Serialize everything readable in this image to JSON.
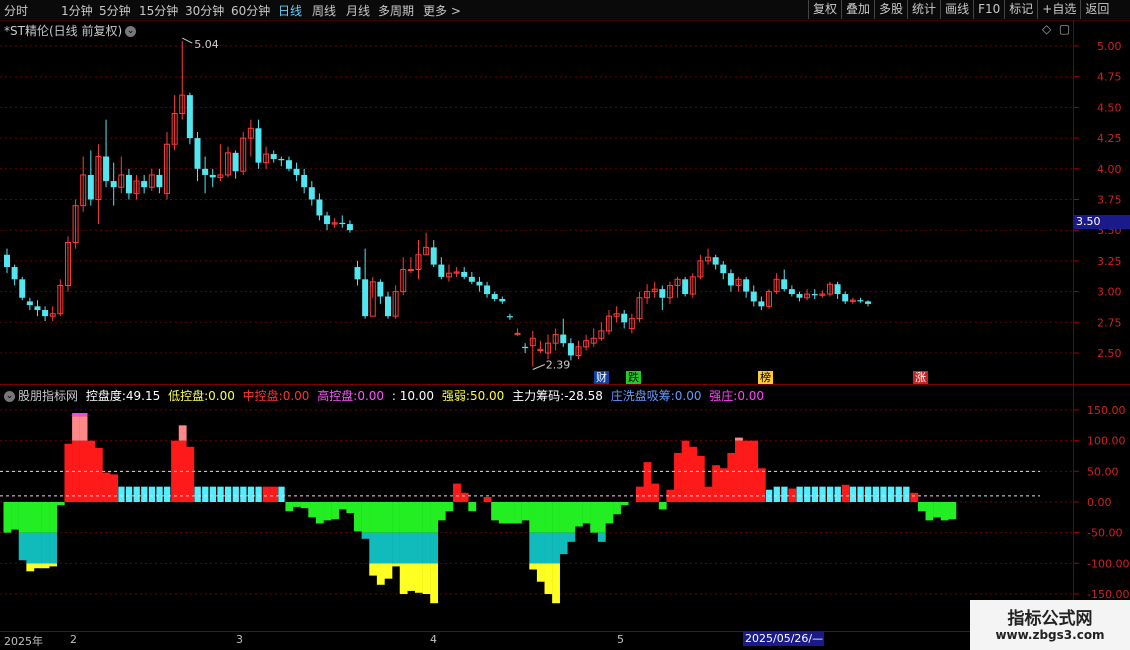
{
  "toolbar": {
    "periods": [
      "分时",
      "1分钟",
      "5分钟",
      "15分钟",
      "30分钟",
      "60分钟",
      "日线",
      "周线",
      "月线",
      "多周期",
      "更多 >"
    ],
    "active_period": "日线",
    "right_buttons": [
      "复权",
      "叠加",
      "多股",
      "统计",
      "画线",
      "F10",
      "标记",
      "+自选",
      "返回"
    ]
  },
  "chart": {
    "title": "*ST精伦(日线 前复权)",
    "high_marker": "5.04",
    "low_marker": "2.39",
    "current_price": "3.50",
    "price_ticks": [
      "5.00",
      "4.75",
      "4.50",
      "4.25",
      "4.00",
      "3.75",
      "3.50",
      "3.25",
      "3.00",
      "2.75",
      "2.50"
    ]
  },
  "badges": {
    "cai": "财",
    "die": "跌",
    "bang": "榜",
    "zhang": "涨"
  },
  "indicator": {
    "name": "股朋指标网",
    "kongpan_label": "控盘度:",
    "kongpan_value": "49.15",
    "low_label": "低控盘:",
    "low_value": "0.00",
    "mid_label": "中控盘:",
    "mid_value": "0.00",
    "high_label": "高控盘:",
    "high_value": "0.00",
    "sep_value": ": 10.00",
    "qiangruo_label": "强弱:",
    "qiangruo_value": "50.00",
    "chouma_label": "主力筹码:",
    "chouma_value": "-28.58",
    "xipan_label": "庄洗盘吸筹:",
    "xipan_value": "0.00",
    "qiangzhuang_label": "强庄:",
    "qiangzhuang_value": "0.00",
    "ticks": [
      "150.00",
      "100.00",
      "50.00",
      "0.00",
      "-50.00",
      "-100.00",
      "-150.00"
    ]
  },
  "dates": {
    "year": "2025年",
    "m2": "2",
    "m3": "3",
    "m4": "4",
    "m5": "5",
    "cursor": "2025/05/26/—"
  },
  "watermark": {
    "line1": "指标公式网",
    "line2": "www.zbgs3.com"
  },
  "colors": {
    "up": "#ff3b3b",
    "down": "#54e6f0",
    "bar_red": "#ff1a1a",
    "bar_pink": "#ff8888",
    "bar_magenta": "#ff44ff",
    "bar_green": "#22ee22",
    "bar_teal": "#11bbbb",
    "bar_yellow": "#ffff22",
    "bar_cyan": "#55eeff"
  },
  "chart_data": {
    "type": "candlestick+bar",
    "candles": [
      [
        3.3,
        3.2,
        3.35,
        3.15
      ],
      [
        3.2,
        3.1,
        3.22,
        3.05
      ],
      [
        3.1,
        2.95,
        3.12,
        2.93
      ],
      [
        2.92,
        2.89,
        2.95,
        2.85
      ],
      [
        2.88,
        2.85,
        2.93,
        2.8
      ],
      [
        2.85,
        2.8,
        2.88,
        2.76
      ],
      [
        2.8,
        2.82,
        2.88,
        2.76
      ],
      [
        2.82,
        3.05,
        3.1,
        2.8
      ],
      [
        3.05,
        3.4,
        3.45,
        3.0
      ],
      [
        3.4,
        3.7,
        3.75,
        3.35
      ],
      [
        3.7,
        3.95,
        4.1,
        3.65
      ],
      [
        3.95,
        3.75,
        4.15,
        3.7
      ],
      [
        3.75,
        4.1,
        4.2,
        3.55
      ],
      [
        4.1,
        3.9,
        4.4,
        3.85
      ],
      [
        3.9,
        3.85,
        4.05,
        3.7
      ],
      [
        3.85,
        3.95,
        4.1,
        3.8
      ],
      [
        3.95,
        3.8,
        4.0,
        3.75
      ],
      [
        3.8,
        3.9,
        3.95,
        3.75
      ],
      [
        3.9,
        3.85,
        3.95,
        3.8
      ],
      [
        3.85,
        3.95,
        4.0,
        3.82
      ],
      [
        3.95,
        3.85,
        4.0,
        3.8
      ],
      [
        3.8,
        4.2,
        4.3,
        3.75
      ],
      [
        4.2,
        4.45,
        4.6,
        4.15
      ],
      [
        4.45,
        4.6,
        5.04,
        4.4
      ],
      [
        4.6,
        4.25,
        4.62,
        4.2
      ],
      [
        4.25,
        4.0,
        4.3,
        3.9
      ],
      [
        4.0,
        3.95,
        4.1,
        3.8
      ],
      [
        3.95,
        3.93,
        4.0,
        3.85
      ],
      [
        3.93,
        3.95,
        4.2,
        3.9
      ],
      [
        3.95,
        4.13,
        4.18,
        3.93
      ],
      [
        4.13,
        3.98,
        4.15,
        3.92
      ],
      [
        3.98,
        4.25,
        4.3,
        3.95
      ],
      [
        4.25,
        4.33,
        4.4,
        4.1
      ],
      [
        4.33,
        4.05,
        4.4,
        4.0
      ],
      [
        4.05,
        4.12,
        4.18,
        4.0
      ],
      [
        4.12,
        4.08,
        4.15,
        4.05
      ],
      [
        4.08,
        4.07,
        4.1,
        4.02
      ],
      [
        4.07,
        4.0,
        4.1,
        3.98
      ],
      [
        4.0,
        3.95,
        4.05,
        3.9
      ],
      [
        3.95,
        3.85,
        4.0,
        3.8
      ],
      [
        3.85,
        3.75,
        3.9,
        3.7
      ],
      [
        3.75,
        3.62,
        3.8,
        3.58
      ],
      [
        3.62,
        3.55,
        3.65,
        3.5
      ],
      [
        3.55,
        3.56,
        3.6,
        3.52
      ],
      [
        3.56,
        3.55,
        3.62,
        3.52
      ],
      [
        3.55,
        3.5,
        3.58,
        3.48
      ],
      [
        3.2,
        3.1,
        3.25,
        3.05
      ],
      [
        3.1,
        2.8,
        3.35,
        2.78
      ],
      [
        2.8,
        3.08,
        3.12,
        2.95
      ],
      [
        3.08,
        2.96,
        3.1,
        2.9
      ],
      [
        2.96,
        2.8,
        3.0,
        2.78
      ],
      [
        2.8,
        3.0,
        3.05,
        2.78
      ],
      [
        3.0,
        3.18,
        3.28,
        2.97
      ],
      [
        3.18,
        3.18,
        3.28,
        3.15
      ],
      [
        3.18,
        3.3,
        3.42,
        3.1
      ],
      [
        3.3,
        3.36,
        3.48,
        3.3
      ],
      [
        3.36,
        3.22,
        3.42,
        3.2
      ],
      [
        3.22,
        3.12,
        3.28,
        3.1
      ],
      [
        3.12,
        3.15,
        3.22,
        3.08
      ],
      [
        3.15,
        3.16,
        3.2,
        3.12
      ],
      [
        3.16,
        3.12,
        3.2,
        3.1
      ],
      [
        3.12,
        3.08,
        3.16,
        3.06
      ],
      [
        3.08,
        3.05,
        3.12,
        3.0
      ],
      [
        3.05,
        2.98,
        3.08,
        2.95
      ],
      [
        2.98,
        2.94,
        3.0,
        2.92
      ],
      [
        2.94,
        2.92,
        2.96,
        2.9
      ],
      [
        2.8,
        2.79,
        2.82,
        2.77
      ],
      [
        2.66,
        2.66,
        2.7,
        2.64
      ],
      [
        2.55,
        2.54,
        2.58,
        2.5
      ],
      [
        2.56,
        2.62,
        2.68,
        2.39
      ],
      [
        2.52,
        2.53,
        2.6,
        2.5
      ],
      [
        2.5,
        2.58,
        2.65,
        2.45
      ],
      [
        2.58,
        2.65,
        2.7,
        2.52
      ],
      [
        2.65,
        2.58,
        2.78,
        2.55
      ],
      [
        2.58,
        2.48,
        2.62,
        2.44
      ],
      [
        2.48,
        2.55,
        2.6,
        2.45
      ],
      [
        2.55,
        2.6,
        2.65,
        2.52
      ],
      [
        2.58,
        2.62,
        2.7,
        2.55
      ],
      [
        2.62,
        2.68,
        2.75,
        2.6
      ],
      [
        2.68,
        2.8,
        2.85,
        2.65
      ],
      [
        2.8,
        2.82,
        2.88,
        2.75
      ],
      [
        2.82,
        2.75,
        2.85,
        2.7
      ],
      [
        2.7,
        2.78,
        2.82,
        2.66
      ],
      [
        2.78,
        2.95,
        3.0,
        2.75
      ],
      [
        2.95,
        3.0,
        3.06,
        2.9
      ],
      [
        3.0,
        3.02,
        3.08,
        2.95
      ],
      [
        3.02,
        2.95,
        3.05,
        2.85
      ],
      [
        2.95,
        3.05,
        3.08,
        2.9
      ],
      [
        3.05,
        3.1,
        3.12,
        2.95
      ],
      [
        3.1,
        2.98,
        3.12,
        2.96
      ],
      [
        2.98,
        3.12,
        3.15,
        2.95
      ],
      [
        3.12,
        3.25,
        3.3,
        3.1
      ],
      [
        3.25,
        3.28,
        3.35,
        3.22
      ],
      [
        3.28,
        3.22,
        3.3,
        3.18
      ],
      [
        3.22,
        3.15,
        3.25,
        3.1
      ],
      [
        3.15,
        3.05,
        3.18,
        3.0
      ],
      [
        3.05,
        3.1,
        3.12,
        3.0
      ],
      [
        3.1,
        3.0,
        3.12,
        2.95
      ],
      [
        3.0,
        2.92,
        3.05,
        2.88
      ],
      [
        2.92,
        2.88,
        2.96,
        2.85
      ],
      [
        2.88,
        3.0,
        3.02,
        2.86
      ],
      [
        3.0,
        3.1,
        3.15,
        2.98
      ],
      [
        3.1,
        3.02,
        3.18,
        3.0
      ],
      [
        3.02,
        2.98,
        3.05,
        2.96
      ],
      [
        2.98,
        2.95,
        3.0,
        2.92
      ],
      [
        2.95,
        2.98,
        3.02,
        2.93
      ],
      [
        2.98,
        2.97,
        3.02,
        2.94
      ],
      [
        2.97,
        2.98,
        3.01,
        2.95
      ],
      [
        2.98,
        3.06,
        3.08,
        2.96
      ],
      [
        3.06,
        2.98,
        3.08,
        2.94
      ],
      [
        2.98,
        2.92,
        3.0,
        2.9
      ],
      [
        2.92,
        2.93,
        2.95,
        2.9
      ],
      [
        2.93,
        2.92,
        2.95,
        2.91
      ],
      [
        2.92,
        2.9,
        2.93,
        2.88
      ]
    ],
    "indicator_bars": [
      [
        -0.5,
        -50,
        0
      ],
      [
        -0.5,
        -45,
        0
      ],
      [
        -0.5,
        -95,
        0
      ],
      [
        -0.5,
        -113,
        0
      ],
      [
        -0.5,
        -108,
        0
      ],
      [
        -0.5,
        -108,
        0
      ],
      [
        -0.5,
        -105,
        0
      ],
      [
        -0.5,
        -5,
        0
      ],
      [
        0.5,
        95,
        0
      ],
      [
        0.5,
        145,
        0
      ],
      [
        0.5,
        145,
        0
      ],
      [
        0.5,
        100,
        0
      ],
      [
        0.5,
        88,
        0
      ],
      [
        0.5,
        48,
        0
      ],
      [
        0.5,
        45,
        0
      ],
      [
        1,
        25,
        0
      ],
      [
        1,
        25,
        0
      ],
      [
        1,
        25,
        0
      ],
      [
        1,
        25,
        0
      ],
      [
        1,
        25,
        0
      ],
      [
        1,
        25,
        0
      ],
      [
        1,
        25,
        0
      ],
      [
        0.5,
        100,
        0
      ],
      [
        0.5,
        125,
        0
      ],
      [
        0.5,
        90,
        0
      ],
      [
        1,
        25,
        0
      ],
      [
        1,
        25,
        0
      ],
      [
        1,
        25,
        0
      ],
      [
        1,
        25,
        0
      ],
      [
        1,
        25,
        0
      ],
      [
        1,
        25,
        0
      ],
      [
        1,
        25,
        0
      ],
      [
        1,
        25,
        0
      ],
      [
        1,
        25,
        0
      ],
      [
        0.5,
        25,
        0
      ],
      [
        0.5,
        25,
        0
      ],
      [
        1,
        25,
        0
      ],
      [
        -0.5,
        -15,
        0
      ],
      [
        -0.5,
        -8,
        0
      ],
      [
        -0.5,
        -10,
        0
      ],
      [
        -0.5,
        -25,
        0
      ],
      [
        -0.5,
        -35,
        0
      ],
      [
        -0.5,
        -30,
        0
      ],
      [
        -0.5,
        -28,
        0
      ],
      [
        -0.5,
        -12,
        0
      ],
      [
        -0.5,
        -18,
        0
      ],
      [
        -0.5,
        -48,
        0
      ],
      [
        -0.5,
        -60,
        0
      ],
      [
        -0.5,
        -120,
        0
      ],
      [
        -0.5,
        -135,
        0
      ],
      [
        -0.5,
        -125,
        0
      ],
      [
        -0.5,
        -105,
        0
      ],
      [
        -0.5,
        -150,
        0
      ],
      [
        -0.5,
        -145,
        0
      ],
      [
        -0.5,
        -148,
        0
      ],
      [
        -0.5,
        -150,
        0
      ],
      [
        -0.5,
        -165,
        0
      ],
      [
        -0.5,
        -30,
        0
      ],
      [
        -0.5,
        -15,
        0
      ],
      [
        0.5,
        30,
        0
      ],
      [
        0.5,
        15,
        0
      ],
      [
        -0.5,
        -15,
        0
      ],
      [
        -0.5,
        0,
        0
      ],
      [
        0.5,
        8,
        0
      ],
      [
        -0.5,
        -30,
        0
      ],
      [
        -0.5,
        -35,
        0
      ],
      [
        -0.5,
        -35,
        0
      ],
      [
        -0.5,
        -35,
        0
      ],
      [
        -0.5,
        -30,
        0
      ],
      [
        -0.5,
        -110,
        0
      ],
      [
        -0.5,
        -130,
        0
      ],
      [
        -0.5,
        -150,
        0
      ],
      [
        -0.5,
        -165,
        0
      ],
      [
        -0.5,
        -85,
        0
      ],
      [
        -0.5,
        -65,
        0
      ],
      [
        -0.5,
        -40,
        0
      ],
      [
        -0.5,
        -35,
        0
      ],
      [
        -0.5,
        -50,
        0
      ],
      [
        -0.5,
        -65,
        0
      ],
      [
        -0.5,
        -35,
        0
      ],
      [
        -0.5,
        -20,
        0
      ],
      [
        -0.5,
        -5,
        0
      ],
      [
        0,
        0,
        0
      ],
      [
        0.5,
        25,
        0
      ],
      [
        0.5,
        65,
        0
      ],
      [
        0.5,
        30,
        0
      ],
      [
        -0.5,
        -12,
        0
      ],
      [
        0.5,
        20,
        0
      ],
      [
        0.5,
        80,
        0
      ],
      [
        0.5,
        100,
        0
      ],
      [
        0.5,
        90,
        0
      ],
      [
        0.5,
        75,
        0
      ],
      [
        0.5,
        25,
        0
      ],
      [
        0.5,
        60,
        0
      ],
      [
        0.5,
        55,
        0
      ],
      [
        0.5,
        80,
        0
      ],
      [
        0.5,
        105,
        0
      ],
      [
        0.5,
        100,
        0
      ],
      [
        0.5,
        100,
        0
      ],
      [
        0.5,
        55,
        0
      ],
      [
        1,
        20,
        0
      ],
      [
        1,
        25,
        0
      ],
      [
        1,
        25,
        0
      ],
      [
        0.5,
        22,
        0
      ],
      [
        1,
        25,
        0
      ],
      [
        1,
        25,
        0
      ],
      [
        1,
        25,
        0
      ],
      [
        1,
        25,
        0
      ],
      [
        1,
        25,
        0
      ],
      [
        1,
        25,
        0
      ],
      [
        0.5,
        28,
        0
      ],
      [
        1,
        25,
        0
      ],
      [
        1,
        25,
        0
      ],
      [
        1,
        25,
        0
      ],
      [
        1,
        25,
        0
      ],
      [
        1,
        25,
        0
      ],
      [
        1,
        25,
        0
      ],
      [
        1,
        25,
        0
      ],
      [
        1,
        25,
        0
      ],
      [
        0.5,
        15,
        0
      ],
      [
        -0.5,
        -15,
        0
      ],
      [
        -0.5,
        -30,
        0
      ],
      [
        -0.5,
        -25,
        0
      ],
      [
        -0.5,
        -30,
        0
      ],
      [
        -0.5,
        -28,
        0
      ]
    ],
    "price_ylim": [
      2.35,
      5.15
    ],
    "ind_ylim": [
      -175,
      165
    ],
    "ind_reference_lines": [
      50,
      10
    ]
  }
}
